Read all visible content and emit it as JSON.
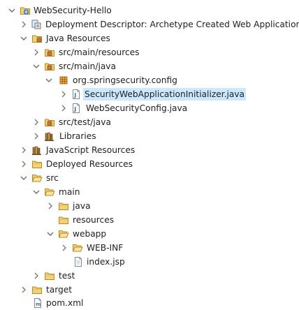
{
  "tree": {
    "project": "WebSecurity-Hello",
    "deployment_descriptor": "Deployment Descriptor: Archetype Created Web Application",
    "java_resources": "Java Resources",
    "src_main_resources": "src/main/resources",
    "src_main_java": "src/main/java",
    "package": "org.springsecurity.config",
    "file_initializer": "SecurityWebApplicationInitializer.java",
    "file_config": "WebSecurityConfig.java",
    "src_test_java": "src/test/java",
    "libraries": "Libraries",
    "javascript_resources": "JavaScript Resources",
    "deployed_resources": "Deployed Resources",
    "src": "src",
    "main": "main",
    "java": "java",
    "resources": "resources",
    "webapp": "webapp",
    "web_inf": "WEB-INF",
    "index_jsp": "index.jsp",
    "test": "test",
    "target": "target",
    "pom": "pom.xml"
  },
  "colors": {
    "selection": "#cce8ff",
    "folder": "#e6b44a",
    "arrow": "#7a7a7a"
  }
}
